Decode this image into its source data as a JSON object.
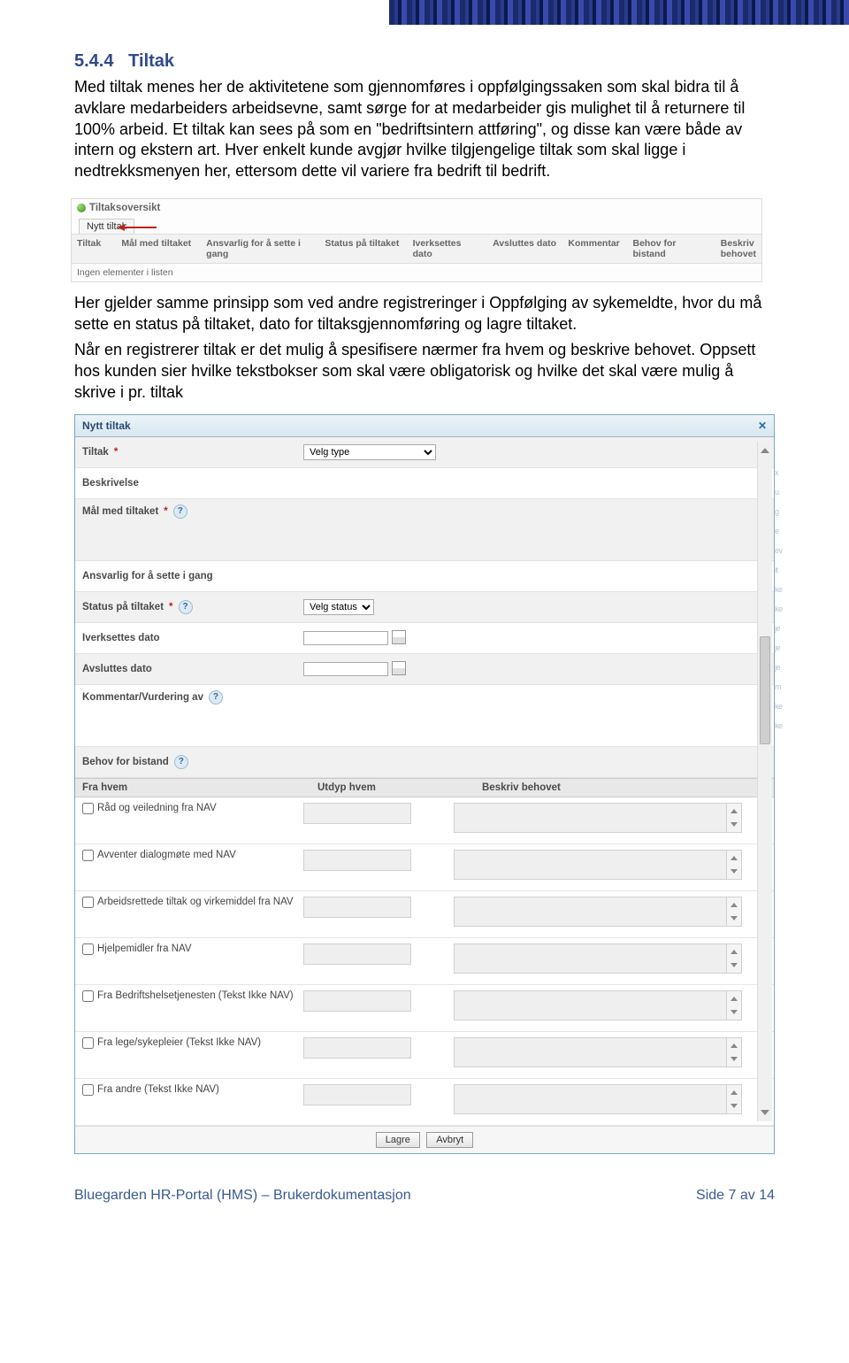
{
  "section": {
    "number": "5.4.4",
    "title": "Tiltak"
  },
  "para1": "Med tiltak menes her de aktivitetene som gjennomføres i oppfølgingssaken som skal bidra til å avklare medarbeiders arbeidsevne, samt sørge for at medarbeider gis mulighet til å returnere til 100% arbeid. Et tiltak kan sees på som en \"bedriftsintern attføring\", og disse kan være både av intern og ekstern art. Hver enkelt kunde avgjør hvilke tilgjengelige tiltak som skal ligge i nedtrekksmenyen her, ettersom dette vil variere fra bedrift til bedrift.",
  "para2": "Her gjelder samme prinsipp som ved andre registreringer i Oppfølging av sykemeldte, hvor du må sette en status på tiltaket, dato for tiltaksgjennomføring og lagre tiltaket.",
  "para3": "Når en registrerer tiltak er det mulig å spesifisere nærmer fra hvem og beskrive behovet. Oppsett hos kunden sier hvilke tekstbokser som skal være obligatorisk og hvilke det skal være mulig å skrive i pr. tiltak",
  "shot1": {
    "header": "Tiltaksoversikt",
    "tab": "Nytt tiltak",
    "cols": [
      "Tiltak",
      "Mål med tiltaket",
      "Ansvarlig for å sette i gang",
      "Status på tiltaket",
      "Iverksettes dato",
      "Avsluttes dato",
      "Kommentar",
      "Behov for bistand",
      "Beskriv behovet"
    ],
    "empty": "Ingen elementer i listen"
  },
  "shot2": {
    "title": "Nytt tiltak",
    "rows": {
      "tiltak": "Tiltak",
      "beskrivelse": "Beskrivelse",
      "maal": "Mål med tiltaket",
      "ansvarlig": "Ansvarlig for å sette i gang",
      "status": "Status på tiltaket",
      "iverksettes": "Iverksettes dato",
      "avsluttes": "Avsluttes dato",
      "kommentar": "Kommentar/Vurdering av",
      "behov": "Behov for bistand"
    },
    "selects": {
      "type": "Velg type",
      "status": "Velg status"
    },
    "bistand_headers": {
      "c1": "Fra hvem",
      "c2": "Utdyp hvem",
      "c3": "Beskriv behovet"
    },
    "bistand": [
      "Råd og veiledning fra NAV",
      "Avventer dialogmøte med NAV",
      "Arbeidsrettede tiltak og virkemiddel fra NAV",
      "Hjelpemidler fra NAV",
      "Fra Bedriftshelsetjenesten (Tekst Ikke NAV)",
      "Fra lege/sykepleier (Tekst Ikke NAV)",
      "Fra andre (Tekst Ikke NAV)"
    ],
    "buttons": {
      "save": "Lagre",
      "cancel": "Avbryt"
    }
  },
  "footer": {
    "left": "Bluegarden HR-Portal (HMS) – Brukerdokumentasjon",
    "right": "Side 7 av 14"
  }
}
